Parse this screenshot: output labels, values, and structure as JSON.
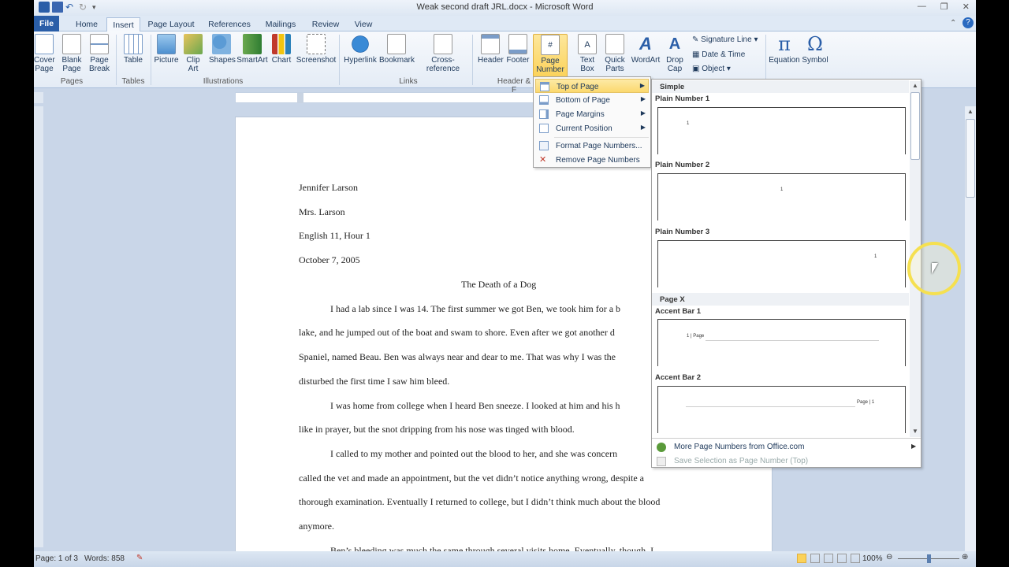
{
  "window": {
    "title": "Weak second draft JRL.docx - Microsoft Word"
  },
  "tabs": [
    "File",
    "Home",
    "Insert",
    "Page Layout",
    "References",
    "Mailings",
    "Review",
    "View"
  ],
  "ribbon": {
    "pages": {
      "cover": "Cover\nPage",
      "blank": "Blank\nPage",
      "break": "Page\nBreak",
      "label": "Pages"
    },
    "tables": {
      "table": "Table",
      "label": "Tables"
    },
    "illustrations": {
      "picture": "Picture",
      "clipart": "Clip\nArt",
      "shapes": "Shapes",
      "smartart": "SmartArt",
      "chart": "Chart",
      "screenshot": "Screenshot",
      "label": "Illustrations"
    },
    "links": {
      "hyperlink": "Hyperlink",
      "bookmark": "Bookmark",
      "crossref": "Cross-reference",
      "label": "Links"
    },
    "headerfooter": {
      "header": "Header",
      "footer": "Footer",
      "pagenumber": "Page\nNumber",
      "label": "Header & F"
    },
    "text": {
      "textbox": "Text\nBox",
      "quickparts": "Quick\nParts",
      "wordart": "WordArt",
      "dropcap": "Drop\nCap",
      "signature": "Signature Line",
      "datetime": "Date & Time",
      "object": "Object"
    },
    "symbols": {
      "equation": "Equation",
      "symbol": "Symbol"
    }
  },
  "menu": {
    "items": [
      "Top of Page",
      "Bottom of Page",
      "Page Margins",
      "Current Position",
      "Format Page Numbers...",
      "Remove Page Numbers"
    ]
  },
  "gallery": {
    "section1": "Simple",
    "plain1": "Plain Number 1",
    "plain2": "Plain Number 2",
    "plain3": "Plain Number 3",
    "section2": "Page X",
    "accent1": "Accent Bar 1",
    "accent2": "Accent Bar 2",
    "num": "1",
    "accent1_text": "1 | Page",
    "accent2_text": "Page | 1",
    "more": "More Page Numbers from Office.com",
    "save": "Save Selection as Page Number (Top)"
  },
  "document": {
    "lines": [
      "Jennifer Larson",
      "Mrs. Larson",
      "English 11, Hour 1",
      "October 7, 2005",
      "The Death of a Dog",
      "I had a lab since I was 14. The first summer we got Ben, we took him for a b",
      "lake, and he jumped out of the boat and swam to shore. Even after we got another d",
      "Spaniel, named Beau. Ben was always near and dear to me. That was why I was the",
      "disturbed the first time I saw him bleed.",
      "I was home from college when I heard Ben sneeze. I looked at him and his h",
      "like in prayer, but the snot dripping from his nose was tinged with blood.",
      "I called to my mother and pointed out the blood to her, and she was concern",
      "called the vet and made an appointment, but the vet didn’t notice anything wrong, despite a",
      "thorough examination. Eventually I returned to college, but I didn’t think much about the blood",
      "anymore.",
      "Ben’s bleeding was much the same through several visits home. Eventually, though, I"
    ]
  },
  "status": {
    "page": "Page: 1 of 3",
    "words": "Words: 858",
    "zoom": "100%"
  },
  "colors": {
    "accent": "#2a5ea8",
    "highlight": "#fbd25a"
  }
}
